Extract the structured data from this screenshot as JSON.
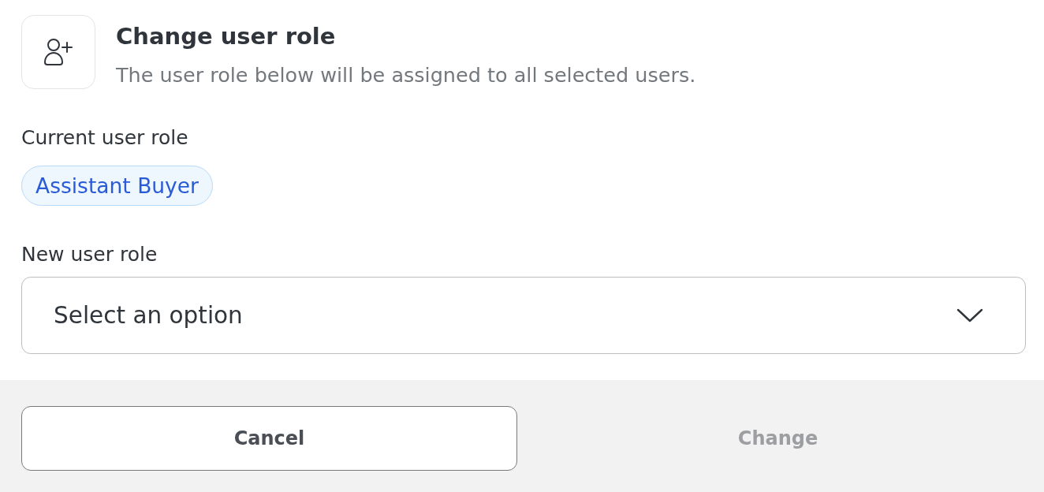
{
  "header": {
    "title": "Change user role",
    "subtitle": "The user role below will be assigned to all selected users."
  },
  "current_role": {
    "label": "Current user role",
    "badge": "Assistant Buyer"
  },
  "new_role": {
    "label": "New user role",
    "placeholder": "Select an option"
  },
  "buttons": [
    {
      "label": "Cancel",
      "kind": "secondary",
      "disabled": false
    },
    {
      "label": "Change",
      "kind": "primary",
      "disabled": true
    }
  ]
}
